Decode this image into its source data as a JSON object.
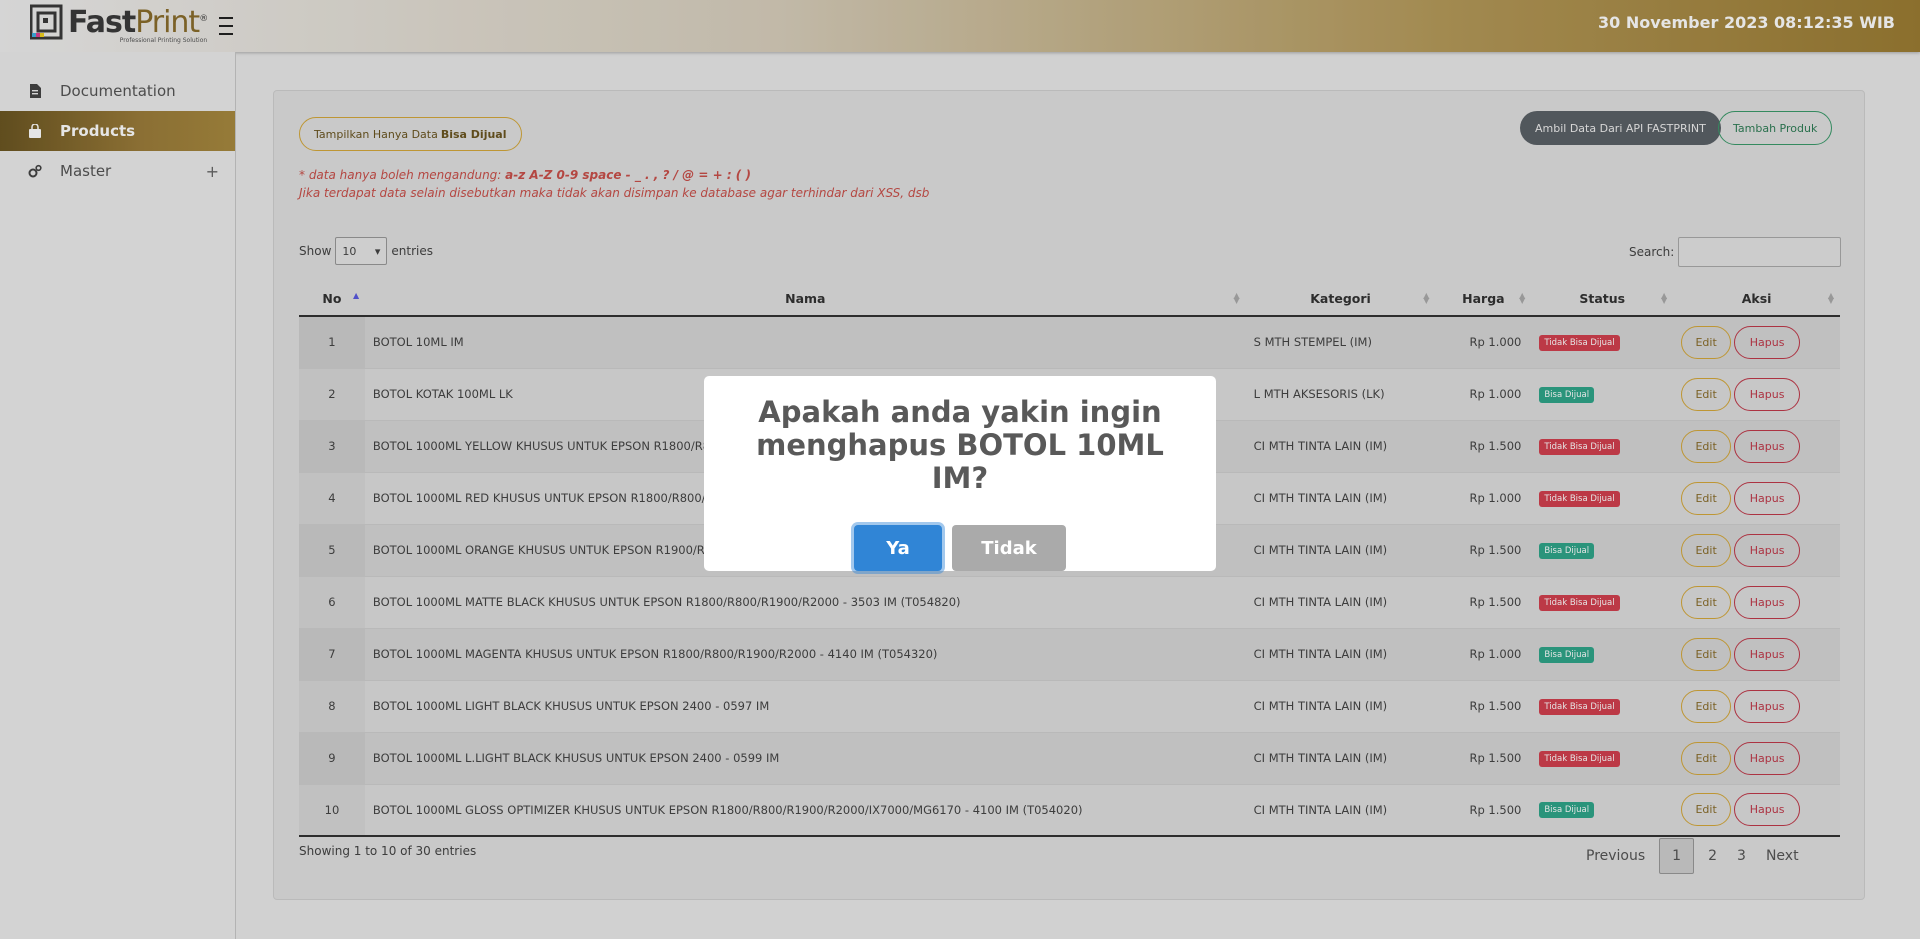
{
  "header": {
    "logo_name_fast": "Fast",
    "logo_name_print": "Print",
    "logo_registered": "®",
    "logo_tagline": "Professional Printing Solution",
    "datetime": "30 November 2023 08:12:35 WIB"
  },
  "sidebar": {
    "items": [
      {
        "label": "Documentation",
        "icon": "document-icon"
      },
      {
        "label": "Products",
        "icon": "shopping-bag-icon",
        "active": true
      },
      {
        "label": "Master",
        "icon": "gears-icon",
        "expand": "+"
      }
    ]
  },
  "toolbar": {
    "filter_prefix": "Tampilkan Hanya Data",
    "filter_bold": "Bisa Dijual",
    "api_button": "Ambil Data Dari API FASTPRINT",
    "add_button": "Tambah Produk"
  },
  "notes": {
    "line1_prefix": "* data hanya boleh mengandung:",
    "line1_bold": "a-z A-Z 0-9 space - _ . , ? / @ = + : ( )",
    "line2": "Jika terdapat data selain disebutkan maka tidak akan disimpan ke database agar terhindar dari XSS, dsb"
  },
  "table_controls": {
    "show_label": "Show",
    "entries_value": "10",
    "entries_label": "entries",
    "search_label": "Search:"
  },
  "table": {
    "headers": [
      "No",
      "Nama",
      "Kategori",
      "Harga",
      "Status",
      "Aksi"
    ],
    "rows": [
      {
        "no": "1",
        "nama": "BOTOL 10ML IM",
        "kategori": "S MTH STEMPEL (IM)",
        "harga": "Rp 1.000",
        "status": "Tidak Bisa Dijual",
        "status_color": "#d2404e"
      },
      {
        "no": "2",
        "nama": "BOTOL KOTAK 100ML LK",
        "kategori": "L MTH AKSESORIS (LK)",
        "harga": "Rp 1.000",
        "status": "Bisa Dijual",
        "status_color": "#2fa58a"
      },
      {
        "no": "3",
        "nama": "BOTOL 1000ML YELLOW KHUSUS UNTUK EPSON R1800/R800",
        "kategori": "CI MTH TINTA LAIN (IM)",
        "harga": "Rp 1.500",
        "status": "Tidak Bisa Dijual",
        "status_color": "#d2404e"
      },
      {
        "no": "4",
        "nama": "BOTOL 1000ML RED KHUSUS UNTUK EPSON R1800/R800/R1",
        "kategori": "CI MTH TINTA LAIN (IM)",
        "harga": "Rp 1.000",
        "status": "Tidak Bisa Dijual",
        "status_color": "#d2404e"
      },
      {
        "no": "5",
        "nama": "BOTOL 1000ML ORANGE KHUSUS UNTUK EPSON R1900/R20",
        "kategori": "CI MTH TINTA LAIN (IM)",
        "harga": "Rp 1.500",
        "status": "Bisa Dijual",
        "status_color": "#2fa58a"
      },
      {
        "no": "6",
        "nama": "BOTOL 1000ML MATTE BLACK KHUSUS UNTUK EPSON R1800/R800/R1900/R2000 - 3503 IM (T054820)",
        "kategori": "CI MTH TINTA LAIN (IM)",
        "harga": "Rp 1.500",
        "status": "Tidak Bisa Dijual",
        "status_color": "#d2404e"
      },
      {
        "no": "7",
        "nama": "BOTOL 1000ML MAGENTA KHUSUS UNTUK EPSON R1800/R800/R1900/R2000 - 4140 IM (T054320)",
        "kategori": "CI MTH TINTA LAIN (IM)",
        "harga": "Rp 1.000",
        "status": "Bisa Dijual",
        "status_color": "#2fa58a"
      },
      {
        "no": "8",
        "nama": "BOTOL 1000ML LIGHT BLACK KHUSUS UNTUK EPSON 2400 - 0597 IM",
        "kategori": "CI MTH TINTA LAIN (IM)",
        "harga": "Rp 1.500",
        "status": "Tidak Bisa Dijual",
        "status_color": "#d2404e"
      },
      {
        "no": "9",
        "nama": "BOTOL 1000ML L.LIGHT BLACK KHUSUS UNTUK EPSON 2400 - 0599 IM",
        "kategori": "CI MTH TINTA LAIN (IM)",
        "harga": "Rp 1.500",
        "status": "Tidak Bisa Dijual",
        "status_color": "#d2404e"
      },
      {
        "no": "10",
        "nama": "BOTOL 1000ML GLOSS OPTIMIZER KHUSUS UNTUK EPSON R1800/R800/R1900/R2000/IX7000/MG6170 - 4100 IM (T054020)",
        "kategori": "CI MTH TINTA LAIN (IM)",
        "harga": "Rp 1.500",
        "status": "Bisa Dijual",
        "status_color": "#2fa58a"
      }
    ],
    "edit_label": "Edit",
    "hapus_label": "Hapus"
  },
  "footer": {
    "showing": "Showing 1 to 10 of 30 entries",
    "pagination": [
      "Previous",
      "1",
      "2",
      "3",
      "Next"
    ],
    "current_page": "1"
  },
  "modal": {
    "title": "Apakah anda yakin ingin menghapus BOTOL 10ML IM?",
    "confirm": "Ya",
    "cancel": "Tidak"
  },
  "colors": {
    "brand_gold": "#9b7c33",
    "confirm_blue": "#3085d6",
    "danger_red": "#c0394a"
  }
}
